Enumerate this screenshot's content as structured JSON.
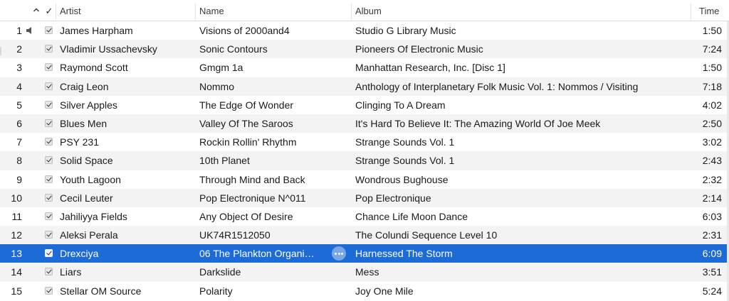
{
  "columns": {
    "sort_icon": "chevron-up-icon",
    "check": "✓",
    "artist": "Artist",
    "name": "Name",
    "album": "Album",
    "time": "Time"
  },
  "colors": {
    "selection": "#1d6bd6",
    "alt_row": "#f3f3f3"
  },
  "selected_row": 13,
  "playing_row": 1,
  "rows": [
    {
      "num": "1",
      "artist": "James Harpham",
      "name": "Visions of 2000and4",
      "album": "Studio G Library Music",
      "time": "1:50"
    },
    {
      "num": "2",
      "artist": "Vladimir Ussachevsky",
      "name": "Sonic Contours",
      "album": "Pioneers Of Electronic Music",
      "time": "7:24"
    },
    {
      "num": "3",
      "artist": "Raymond Scott",
      "name": "Gmgm 1a",
      "album": "Manhattan Research, Inc. [Disc 1]",
      "time": "1:50"
    },
    {
      "num": "4",
      "artist": "Craig Leon",
      "name": "Nommo",
      "album": "Anthology of Interplanetary Folk Music Vol. 1: Nommos / Visiting",
      "time": "7:18"
    },
    {
      "num": "5",
      "artist": "Silver Apples",
      "name": "The Edge Of Wonder",
      "album": "Clinging To A Dream",
      "time": "4:02"
    },
    {
      "num": "6",
      "artist": "Blues Men",
      "name": "Valley Of The Saroos",
      "album": "It's Hard To Believe It: The Amazing World Of Joe Meek",
      "time": "2:50"
    },
    {
      "num": "7",
      "artist": "PSY 231",
      "name": "Rockin Rollin' Rhythm",
      "album": "Strange Sounds Vol. 1",
      "time": "3:02"
    },
    {
      "num": "8",
      "artist": "Solid Space",
      "name": "10th Planet",
      "album": "Strange Sounds Vol. 1",
      "time": "2:43"
    },
    {
      "num": "9",
      "artist": "Youth Lagoon",
      "name": "Through Mind and Back",
      "album": "Wondrous Bughouse",
      "time": "2:32"
    },
    {
      "num": "10",
      "artist": "Cecil Leuter",
      "name": "Pop Electronique N^011",
      "album": "Pop Electronique",
      "time": "2:14"
    },
    {
      "num": "11",
      "artist": "Jahiliyya Fields",
      "name": "Any Object Of Desire",
      "album": "Chance Life Moon Dance",
      "time": "6:03"
    },
    {
      "num": "12",
      "artist": "Aleksi Perala",
      "name": "UK74R1512050",
      "album": "The Colundi Sequence Level 10",
      "time": "2:31"
    },
    {
      "num": "13",
      "artist": "Drexciya",
      "name": "06 The Plankton Organi…",
      "album": "Harnessed The Storm",
      "time": "6:09"
    },
    {
      "num": "14",
      "artist": "Liars",
      "name": "Darkslide",
      "album": "Mess",
      "time": "3:51"
    },
    {
      "num": "15",
      "artist": "Stellar OM Source",
      "name": "Polarity",
      "album": "Joy One Mile",
      "time": "5:24"
    }
  ]
}
